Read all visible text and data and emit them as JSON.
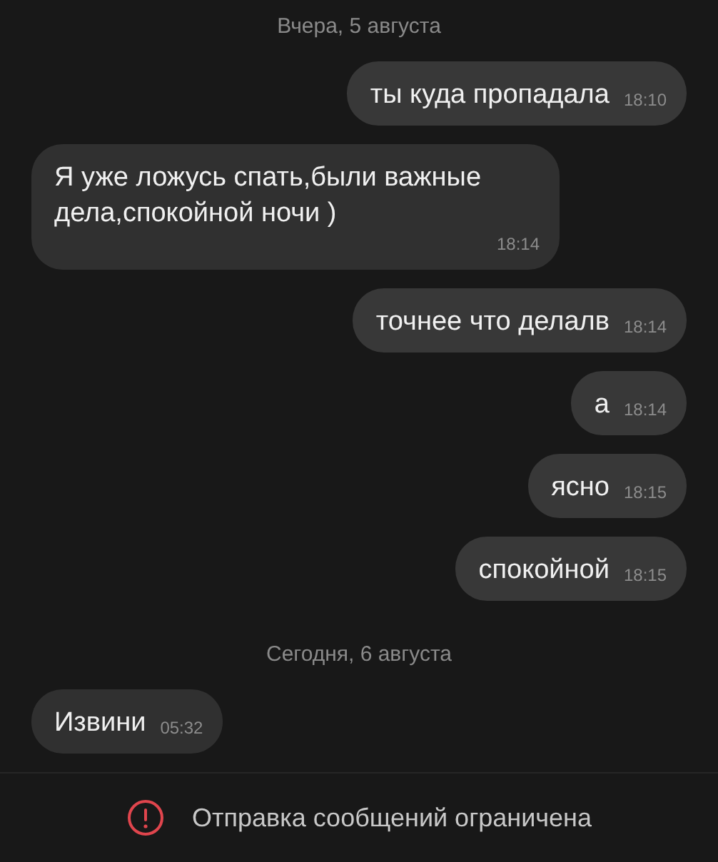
{
  "messages": [
    {
      "kind": "date",
      "text": "Вчера, 5 августа"
    },
    {
      "kind": "outgoing",
      "text": "ты куда пропадала",
      "time": "18:10"
    },
    {
      "kind": "incoming",
      "text": "Я уже ложусь спать,были важные дела,спокойной ночи )",
      "time": "18:14"
    },
    {
      "kind": "outgoing",
      "text": "точнее что делалв",
      "time": "18:14"
    },
    {
      "kind": "outgoing",
      "text": "а",
      "time": "18:14"
    },
    {
      "kind": "outgoing",
      "text": "ясно",
      "time": "18:15"
    },
    {
      "kind": "outgoing",
      "text": "спокойной",
      "time": "18:15"
    },
    {
      "kind": "date",
      "text": "Сегодня, 6 августа"
    },
    {
      "kind": "incoming",
      "text": "Извини",
      "time": "05:32"
    }
  ],
  "notice": {
    "text": "Отправка сообщений ограничена"
  }
}
